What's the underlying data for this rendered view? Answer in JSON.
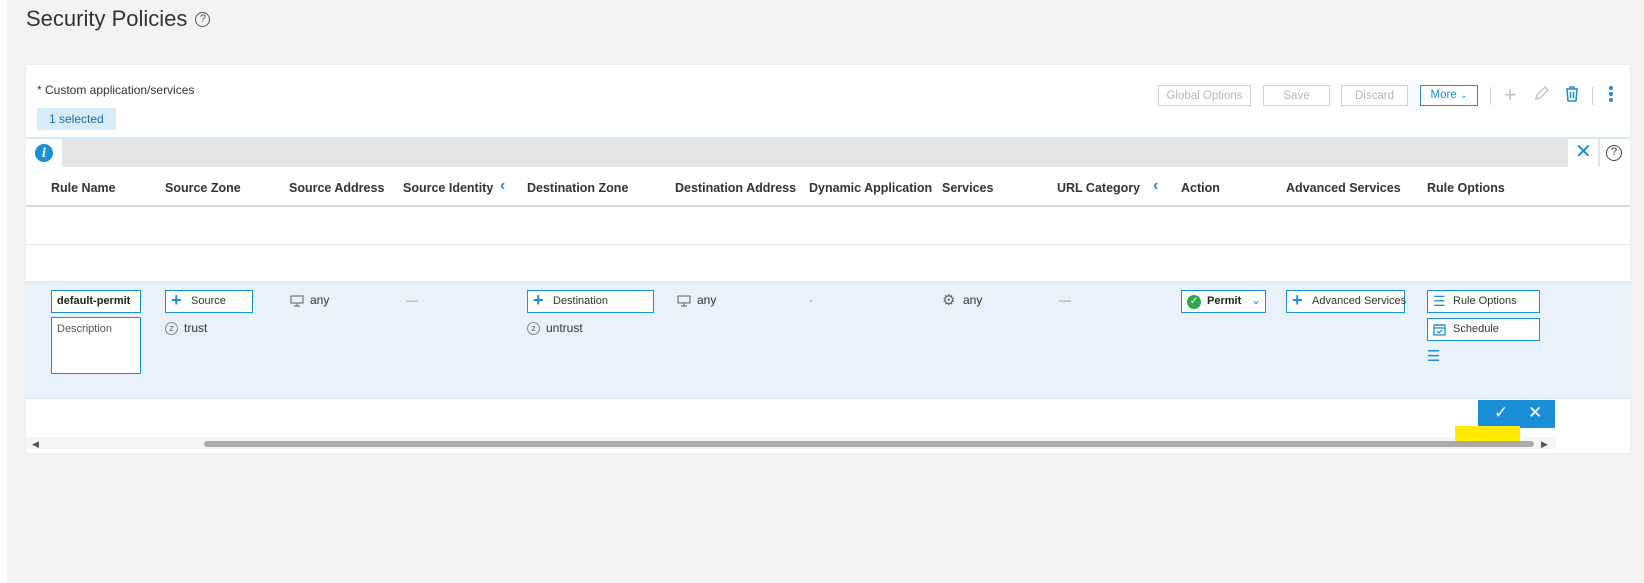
{
  "page": {
    "title": "Security Policies",
    "help_glyph": "?"
  },
  "panel": {
    "note": "* Custom application/services",
    "selected_badge": "1 selected"
  },
  "toolbar": {
    "global_options": "Global Options",
    "save": "Save",
    "discard": "Discard",
    "more": "More"
  },
  "info_bar": {
    "info_glyph": "i",
    "close_glyph": "✕",
    "help_glyph": "?"
  },
  "columns": [
    "Rule Name",
    "Source Zone",
    "Source Address",
    "Source Identity",
    "Destination Zone",
    "Destination Address",
    "Dynamic Application",
    "Services",
    "URL Category",
    "Action",
    "Advanced Services",
    "Rule Options"
  ],
  "edit_row": {
    "rule_name": "default-permit",
    "description_placeholder": "Description",
    "source_zone": {
      "button": "Source",
      "value": "trust",
      "icon_glyph": "z"
    },
    "source_address": "any",
    "source_identity": "—",
    "destination_zone": {
      "button": "Destination",
      "value": "untrust",
      "icon_glyph": "z"
    },
    "destination_address": "any",
    "dynamic_application": "-",
    "services": "any",
    "url_category": "—",
    "action": "Permit",
    "advanced_services": "Advanced Services",
    "rule_options": "Rule Options",
    "schedule": "Schedule"
  },
  "colors": {
    "accent": "#1a8fd8",
    "permit": "#2fa84f",
    "highlight": "#ffeb00"
  }
}
